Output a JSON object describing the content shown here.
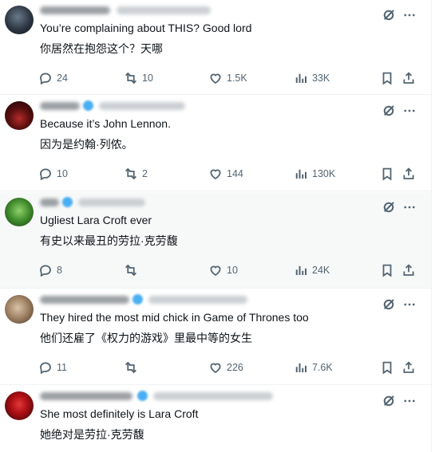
{
  "colors": {
    "text": "#0f1419",
    "muted": "#536471",
    "divider": "#eff3f4",
    "highlight_bg": "#f7f9f9",
    "verified": "#1d9bf0"
  },
  "icons": [
    "grok-icon",
    "more-icon",
    "reply-icon",
    "retweet-icon",
    "like-icon",
    "views-icon",
    "bookmark-icon",
    "share-icon"
  ],
  "replies": [
    {
      "text": "You’re complaining about THIS? Good lord",
      "translation": "你居然在抱怨这个？天哪",
      "counts": {
        "replies": "24",
        "reposts": "10",
        "likes": "1.5K",
        "views": "33K"
      }
    },
    {
      "text": "Because it’s John Lennon.",
      "translation": "因为是约翰·列侬。",
      "counts": {
        "replies": "10",
        "reposts": "2",
        "likes": "144",
        "views": "130K"
      }
    },
    {
      "text": "Ugliest Lara Croft ever",
      "translation": "有史以来最丑的劳拉·克劳馥",
      "counts": {
        "replies": "8",
        "reposts": "",
        "likes": "10",
        "views": "24K"
      }
    },
    {
      "text": "They hired the most mid chick in Game of Thrones too",
      "translation": "他们还雇了《权力的游戏》里最中等的女生",
      "counts": {
        "replies": "11",
        "reposts": "",
        "likes": "226",
        "views": "7.6K"
      }
    },
    {
      "text": "She most definitely is Lara Croft",
      "translation": "她绝对是劳拉·克劳馥",
      "counts": {
        "replies": "",
        "reposts": "",
        "likes": "",
        "views": ""
      }
    }
  ]
}
